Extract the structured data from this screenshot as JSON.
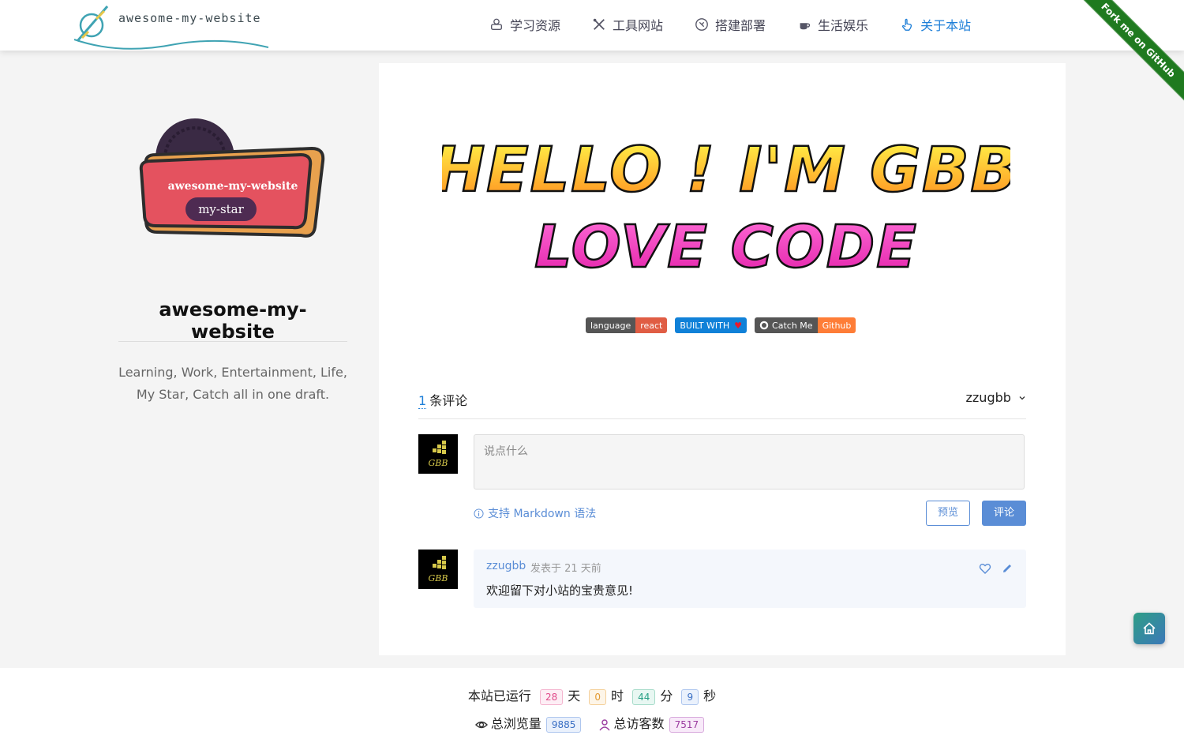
{
  "header": {
    "logo_text": "awesome-my-website",
    "nav": [
      {
        "label": "学习资源",
        "icon": "learning-icon"
      },
      {
        "label": "工具网站",
        "icon": "tools-icon"
      },
      {
        "label": "搭建部署",
        "icon": "deploy-icon"
      },
      {
        "label": "生活娱乐",
        "icon": "coffee-icon"
      },
      {
        "label": "关于本站",
        "icon": "pointer-icon",
        "active": true
      }
    ],
    "ribbon": "Fork me on GitHub"
  },
  "sidebar": {
    "badge_title": "awesome-my-website",
    "badge_sub": "my-star",
    "site_name": "awesome-my-website",
    "desc_line1": "Learning, Work, Entertainment, Life,",
    "desc_line2": "My Star, Catch all in one draft."
  },
  "hero": {
    "line1": "HELLO ! I'M GBB",
    "line2": "LOVE CODE"
  },
  "shields": [
    {
      "left": "language",
      "right": "react",
      "left_color": "#555555",
      "right_color": "#e05d44"
    },
    {
      "left": "BUILT WITH",
      "right": "♥",
      "left_color": "#1081d8",
      "right_color": "#1081d8"
    },
    {
      "left": "Catch Me",
      "right": "Github",
      "left_color": "#555555",
      "right_color": "#fe7d37"
    }
  ],
  "comments": {
    "count": "1",
    "count_label": "条评论",
    "user": "zzugbb",
    "placeholder": "说点什么",
    "md_hint": "支持 Markdown 语法",
    "preview_btn": "预览",
    "submit_btn": "评论",
    "avatar_text": "GBB",
    "items": [
      {
        "author": "zzugbb",
        "meta": "发表于 21 天前",
        "body": "欢迎留下对小站的宝贵意见!"
      }
    ]
  },
  "footer": {
    "runtime_prefix": "本站已运行",
    "days": "28",
    "days_unit": "天",
    "hours": "0",
    "hours_unit": "时",
    "minutes": "44",
    "minutes_unit": "分",
    "seconds": "9",
    "seconds_unit": "秒",
    "views_label": "总浏览量",
    "views": "9885",
    "visitors_label": "总访客数",
    "visitors": "7517"
  },
  "colors": {
    "accent": "#1e7fd8",
    "comment_blue": "#5a8dd6"
  }
}
